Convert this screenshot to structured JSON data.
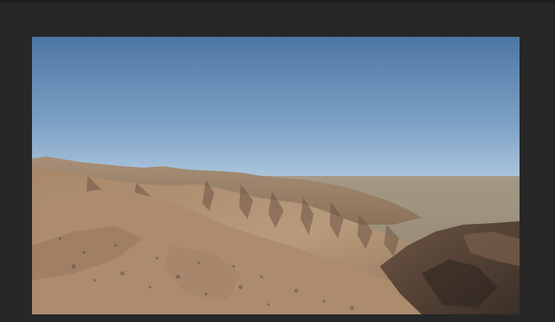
{
  "window": {
    "title": ""
  },
  "viewport": {
    "scene": "terrain-flyover",
    "colors": {
      "sky_top": "#4f77a4",
      "sky_horizon": "#a9c4dd",
      "terrain_light": "#b9987a",
      "terrain_mid": "#9c7b5f",
      "terrain_dark": "#5b4636",
      "plain": "#9e927d",
      "frame": "#272727"
    }
  }
}
